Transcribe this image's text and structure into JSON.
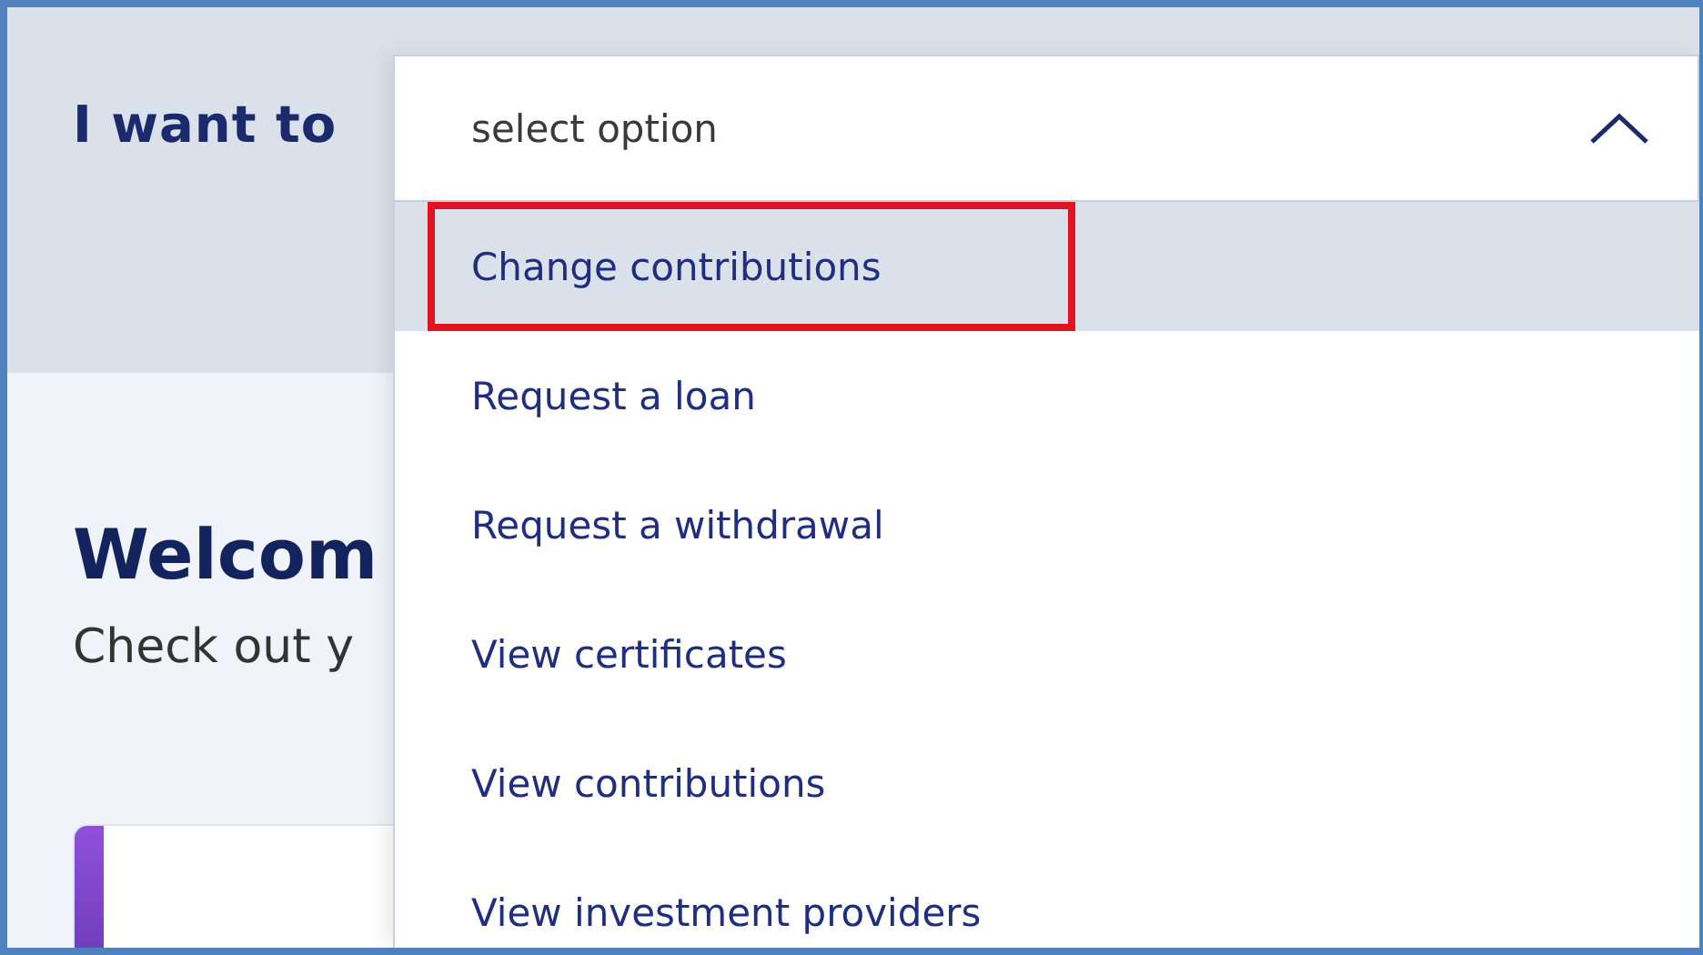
{
  "heading": "I want to",
  "dropdown": {
    "placeholder": "select option",
    "expanded": true,
    "options": [
      {
        "label": "Change contributions",
        "selected": true,
        "outlined": true
      },
      {
        "label": "Request a loan",
        "selected": false,
        "outlined": false
      },
      {
        "label": "Request a withdrawal",
        "selected": false,
        "outlined": false
      },
      {
        "label": "View certificates",
        "selected": false,
        "outlined": false
      },
      {
        "label": "View contributions",
        "selected": false,
        "outlined": false
      },
      {
        "label": "View investment providers",
        "selected": false,
        "outlined": false
      }
    ]
  },
  "welcome": {
    "title": "Welcom",
    "subtitle": "Check out y"
  }
}
